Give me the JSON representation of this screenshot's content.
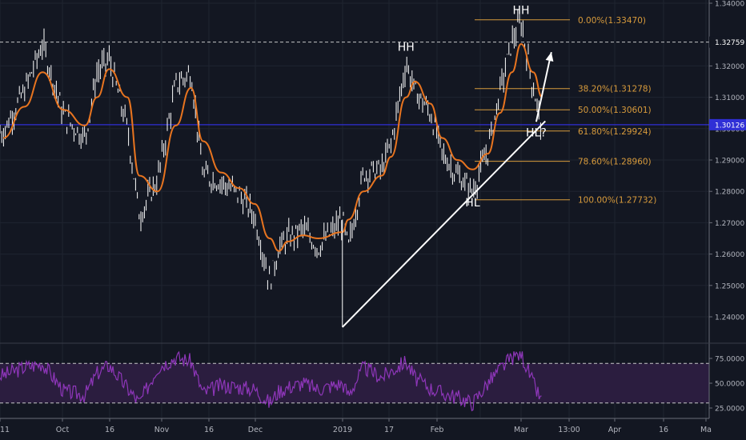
{
  "chart_data": [
    {
      "type": "line",
      "title": "",
      "xlabel": "",
      "ylabel": "",
      "ylim": [
        1.232,
        1.342
      ],
      "y_ticks": [
        "1.34000",
        "1.32000",
        "1.31000",
        "1.30000",
        "1.29000",
        "1.28000",
        "1.27000",
        "1.26000",
        "1.25000",
        "1.24000"
      ],
      "y_tick_values": [
        1.34,
        1.32,
        1.31,
        1.3,
        1.29,
        1.28,
        1.27,
        1.26,
        1.25,
        1.24
      ],
      "x_ticks": [
        "11",
        "Oct",
        "16",
        "Nov",
        "16",
        "Dec",
        "2019",
        "17",
        "Feb",
        "Mar",
        "13:00",
        "Apr",
        "16",
        "Ma"
      ],
      "price_markers": [
        {
          "label": "1.32759",
          "value": 1.32759,
          "style": "dashed",
          "color": "#ffffff"
        },
        {
          "label": "1.30126",
          "value": 1.30126,
          "style": "solid",
          "color": "#2f2fd6"
        }
      ],
      "series": [
        {
          "name": "",
          "color": "#ffffff",
          "x": [
            "Sep 11",
            "Sep 18",
            "Sep 24",
            "Oct 1",
            "Oct 8",
            "Oct 12",
            "Oct 16",
            "Oct 22",
            "Oct 26",
            "Nov 1",
            "Nov 7",
            "Nov 12",
            "Nov 16",
            "Nov 22",
            "Nov 28",
            "Dec 3",
            "Dec 8",
            "Dec 11",
            "Dec 14",
            "Dec 19",
            "Dec 24",
            "Jan 1",
            "Jan 3",
            "Jan 8",
            "Jan 14",
            "Jan 17",
            "Jan 22",
            "Jan 25",
            "Jan 30",
            "Feb 3",
            "Feb 8",
            "Feb 13",
            "Feb 18",
            "Feb 22",
            "Feb 26",
            "Mar 1",
            "Mar 5",
            "Mar 8"
          ],
          "values": [
            1.299,
            1.312,
            1.327,
            1.304,
            1.297,
            1.318,
            1.322,
            1.3,
            1.272,
            1.284,
            1.314,
            1.318,
            1.285,
            1.283,
            1.279,
            1.272,
            1.251,
            1.262,
            1.265,
            1.268,
            1.262,
            1.271,
            1.262,
            1.286,
            1.287,
            1.295,
            1.321,
            1.312,
            1.305,
            1.292,
            1.285,
            1.28,
            1.293,
            1.312,
            1.328,
            1.334,
            1.313,
            1.3
          ]
        },
        {
          "name": "",
          "color": "#e8741f",
          "x": [
            "Sep 11",
            "Sep 18",
            "Sep 24",
            "Oct 1",
            "Oct 8",
            "Oct 12",
            "Oct 16",
            "Oct 22",
            "Oct 26",
            "Nov 1",
            "Nov 7",
            "Nov 12",
            "Nov 16",
            "Nov 22",
            "Nov 28",
            "Dec 3",
            "Dec 8",
            "Dec 11",
            "Dec 14",
            "Dec 19",
            "Dec 24",
            "Jan 1",
            "Jan 3",
            "Jan 8",
            "Jan 14",
            "Jan 17",
            "Jan 22",
            "Jan 25",
            "Jan 30",
            "Feb 3",
            "Feb 8",
            "Feb 13",
            "Feb 18",
            "Feb 22",
            "Feb 26",
            "Mar 1",
            "Mar 5",
            "Mar 8"
          ],
          "values": [
            1.297,
            1.307,
            1.318,
            1.306,
            1.301,
            1.31,
            1.319,
            1.31,
            1.285,
            1.28,
            1.301,
            1.313,
            1.296,
            1.286,
            1.281,
            1.276,
            1.265,
            1.261,
            1.264,
            1.266,
            1.265,
            1.267,
            1.271,
            1.28,
            1.285,
            1.291,
            1.31,
            1.315,
            1.308,
            1.297,
            1.29,
            1.287,
            1.292,
            1.305,
            1.318,
            1.327,
            1.318,
            1.31
          ]
        }
      ],
      "fibonacci": [
        {
          "label": "0.00%(1.33470)",
          "value": 1.3347
        },
        {
          "label": "38.20%(1.31278)",
          "value": 1.31278
        },
        {
          "label": "50.00%(1.30601)",
          "value": 1.30601
        },
        {
          "label": "61.80%(1.29924)",
          "value": 1.29924
        },
        {
          "label": "78.60%(1.28960)",
          "value": 1.2896
        },
        {
          "label": "100.00%(1.27732)",
          "value": 1.27732
        }
      ],
      "annotations": [
        {
          "text": "HH",
          "date": "Mar 1",
          "value": 1.3365
        },
        {
          "text": "HH",
          "date": "Jan 22",
          "value": 1.3248
        },
        {
          "text": "HL",
          "date": "Feb 13",
          "value": 1.2752
        },
        {
          "text": "HL?",
          "date": "Mar 6",
          "value": 1.2975
        }
      ],
      "trendline": {
        "from": {
          "date": "Jan 1",
          "value": 1.2367
        },
        "to": {
          "date": "Mar 9",
          "value": 1.3024
        }
      },
      "arrow": {
        "from": {
          "date": "Mar 6",
          "value": 1.3022
        },
        "to": {
          "date": "Mar 11",
          "value": 1.3244
        }
      },
      "colors": {
        "background": "#131722",
        "fib": "#d89b3c",
        "grid": "#1f2430"
      }
    },
    {
      "type": "line",
      "title": "",
      "ylim": [
        22,
        82
      ],
      "y_ticks": [
        "75.0000",
        "50.0000",
        "25.0000"
      ],
      "y_tick_values": [
        75,
        50,
        25
      ],
      "band": [
        30,
        70
      ],
      "colors": {
        "line": "#8e36b9",
        "band_fill": "#2b1d3f",
        "band_lines": "#c8c8c8"
      },
      "series": [
        {
          "name": "",
          "x": [
            "Sep 11",
            "Sep 18",
            "Sep 24",
            "Oct 1",
            "Oct 8",
            "Oct 12",
            "Oct 16",
            "Oct 22",
            "Oct 26",
            "Nov 1",
            "Nov 7",
            "Nov 12",
            "Nov 16",
            "Nov 22",
            "Nov 28",
            "Dec 3",
            "Dec 8",
            "Dec 11",
            "Dec 14",
            "Dec 19",
            "Dec 24",
            "Jan 1",
            "Jan 3",
            "Jan 8",
            "Jan 14",
            "Jan 17",
            "Jan 22",
            "Jan 25",
            "Jan 30",
            "Feb 3",
            "Feb 8",
            "Feb 13",
            "Feb 18",
            "Feb 22",
            "Feb 26",
            "Mar 1",
            "Mar 5",
            "Mar 8"
          ],
          "values": [
            58,
            66,
            70,
            42,
            38,
            60,
            68,
            45,
            30,
            66,
            76,
            72,
            40,
            48,
            46,
            44,
            30,
            42,
            46,
            50,
            44,
            50,
            38,
            66,
            56,
            62,
            72,
            55,
            45,
            40,
            36,
            30,
            50,
            64,
            76,
            80,
            50,
            30
          ]
        }
      ]
    }
  ]
}
